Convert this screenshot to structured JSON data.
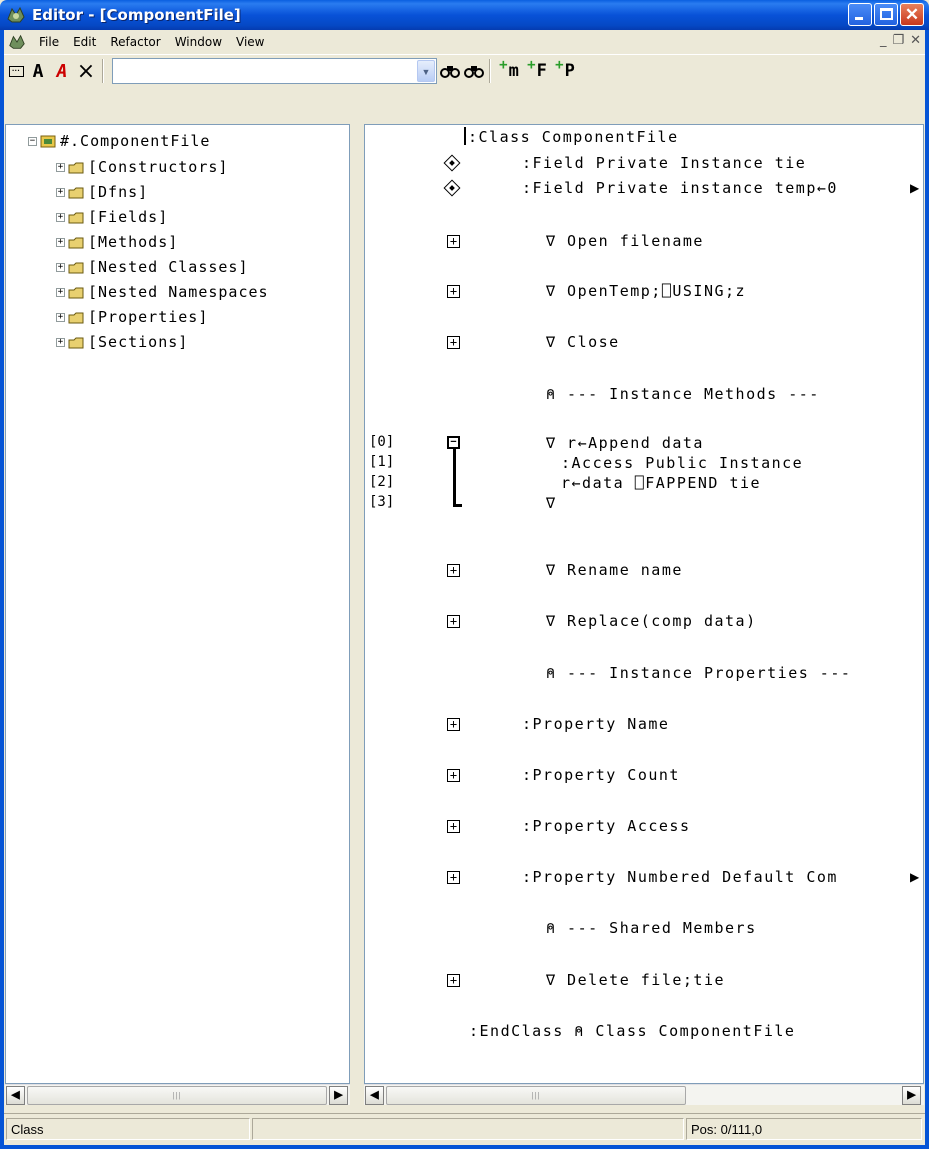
{
  "window": {
    "title": "Editor - [ComponentFile]",
    "buttons": [
      "minimize",
      "maximize",
      "close"
    ]
  },
  "menu": {
    "items": [
      {
        "label": "File"
      },
      {
        "label": "Edit"
      },
      {
        "label": "Refactor"
      },
      {
        "label": "Window"
      },
      {
        "label": "View"
      }
    ]
  },
  "toolbar": {
    "buttons": [
      "[---]",
      "A",
      "A",
      "×"
    ],
    "search": {
      "value": "",
      "placeholder": ""
    },
    "member_buttons": [
      "m",
      "F",
      "P"
    ]
  },
  "tree": {
    "root": "#.ComponentFile",
    "items": [
      "[Constructors]",
      "[Dfns]",
      "[Fields]",
      "[Methods]",
      "[Nested Classes]",
      "[Nested Namespaces",
      "[Properties]",
      "[Sections]"
    ]
  },
  "code": {
    "lines": [
      ":Class ComponentFile",
      ":Field Private Instance tie",
      ":Field Private instance temp←0",
      "∇ Open filename",
      "∇ OpenTemp;⎕USING;z",
      "∇ Close",
      "⍝ --- Instance Methods ---",
      "∇ r←Append data",
      ":Access Public Instance",
      "r←data ⎕FAPPEND tie",
      "∇",
      "∇ Rename name",
      "∇ Replace(comp data)",
      "⍝ --- Instance Properties ---",
      ":Property Name",
      ":Property Count",
      ":Property Access",
      ":Property Numbered Default Com",
      "⍝ --- Shared Members",
      "∇ Delete file;tie",
      ":EndClass ⍝ Class ComponentFile"
    ],
    "line_numbers": [
      "[0]",
      "[1]",
      "[2]",
      "[3]"
    ]
  },
  "status": {
    "left": "Class",
    "middle": "",
    "position": "Pos: 0/111,0"
  }
}
